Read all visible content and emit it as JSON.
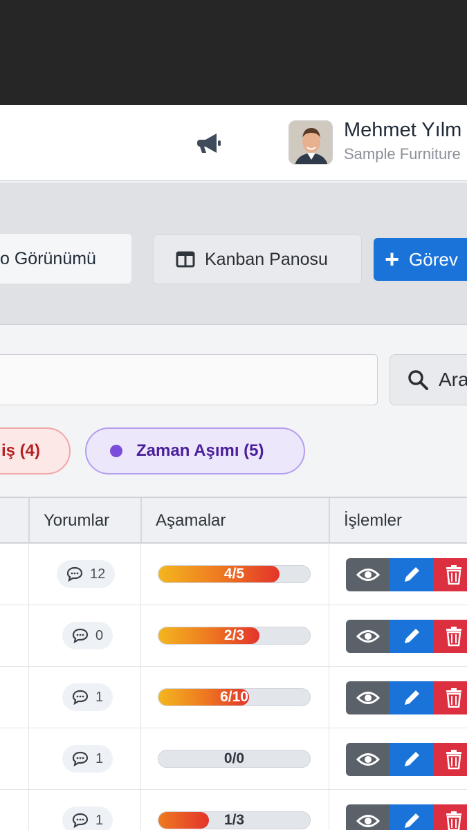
{
  "header": {
    "user_name": "Mehmet Yılm",
    "user_company": "Sample Furniture"
  },
  "toolbar": {
    "list_view_label": "o Görünümü",
    "kanban_label": "Kanban Panosu",
    "add_task_label": "Görev"
  },
  "search": {
    "input_value": "",
    "button_label": "Ara"
  },
  "filters": [
    {
      "label": "iş (4)"
    },
    {
      "label": "Zaman Aşımı (5)"
    }
  ],
  "table": {
    "columns": [
      "Yorumlar",
      "Aşamalar",
      "İşlemler"
    ],
    "rows": [
      {
        "comments": "12",
        "stage_label": "4/5",
        "stage_done": 4,
        "stage_total": 5
      },
      {
        "comments": "0",
        "stage_label": "2/3",
        "stage_done": 2,
        "stage_total": 3
      },
      {
        "comments": "1",
        "stage_label": "6/10",
        "stage_done": 6,
        "stage_total": 10
      },
      {
        "comments": "1",
        "stage_label": "0/0",
        "stage_done": 0,
        "stage_total": 0
      },
      {
        "comments": "1",
        "stage_label": "1/3",
        "stage_done": 1,
        "stage_total": 3
      }
    ]
  },
  "colors": {
    "primary": "#1a73d9",
    "danger": "#dc2f3f",
    "neutral": "#5b6169",
    "overdue_purple": "#7c4ddb",
    "red_filter": "#b42323"
  }
}
